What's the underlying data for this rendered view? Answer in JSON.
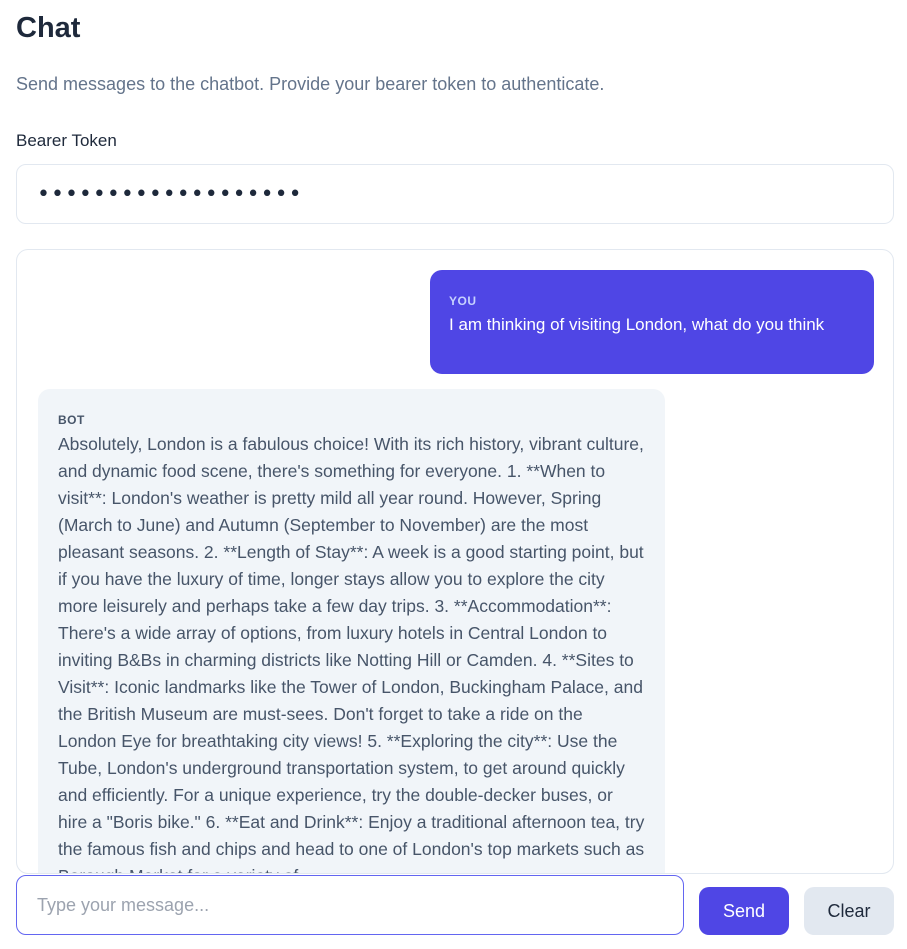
{
  "page": {
    "title": "Chat",
    "subtitle": "Send messages to the chatbot. Provide your bearer token to authenticate."
  },
  "token": {
    "label": "Bearer Token",
    "masked_value": "•••••••••••••••••••"
  },
  "messages": [
    {
      "role": "YOU",
      "text": "I am thinking of visiting London, what do you think"
    },
    {
      "role": "BOT",
      "text": "Absolutely, London is a fabulous choice! With its rich history, vibrant culture, and dynamic food scene, there's something for everyone. 1. **When to visit**: London's weather is pretty mild all year round. However, Spring (March to June) and Autumn (September to November) are the most pleasant seasons. 2. **Length of Stay**: A week is a good starting point, but if you have the luxury of time, longer stays allow you to explore the city more leisurely and perhaps take a few day trips. 3. **Accommodation**: There's a wide array of options, from luxury hotels in Central London to inviting B&Bs in charming districts like Notting Hill or Camden. 4. **Sites to Visit**: Iconic landmarks like the Tower of London, Buckingham Palace, and the British Museum are must-sees. Don't forget to take a ride on the London Eye for breathtaking city views! 5. **Exploring the city**: Use the Tube, London's underground transportation system, to get around quickly and efficiently. For a unique experience, try the double-decker buses, or hire a \"Boris bike.\" 6. **Eat and Drink**: Enjoy a traditional afternoon tea, try the famous fish and chips and head to one of London's top markets such as Borough Market for a variety of"
    }
  ],
  "composer": {
    "placeholder": "Type your message...",
    "value": ""
  },
  "buttons": {
    "send_label": "Send",
    "clear_label": "Clear"
  },
  "colors": {
    "accent": "#4f46e5",
    "bot_bubble": "#f1f5f9",
    "muted_text": "#64748b"
  }
}
